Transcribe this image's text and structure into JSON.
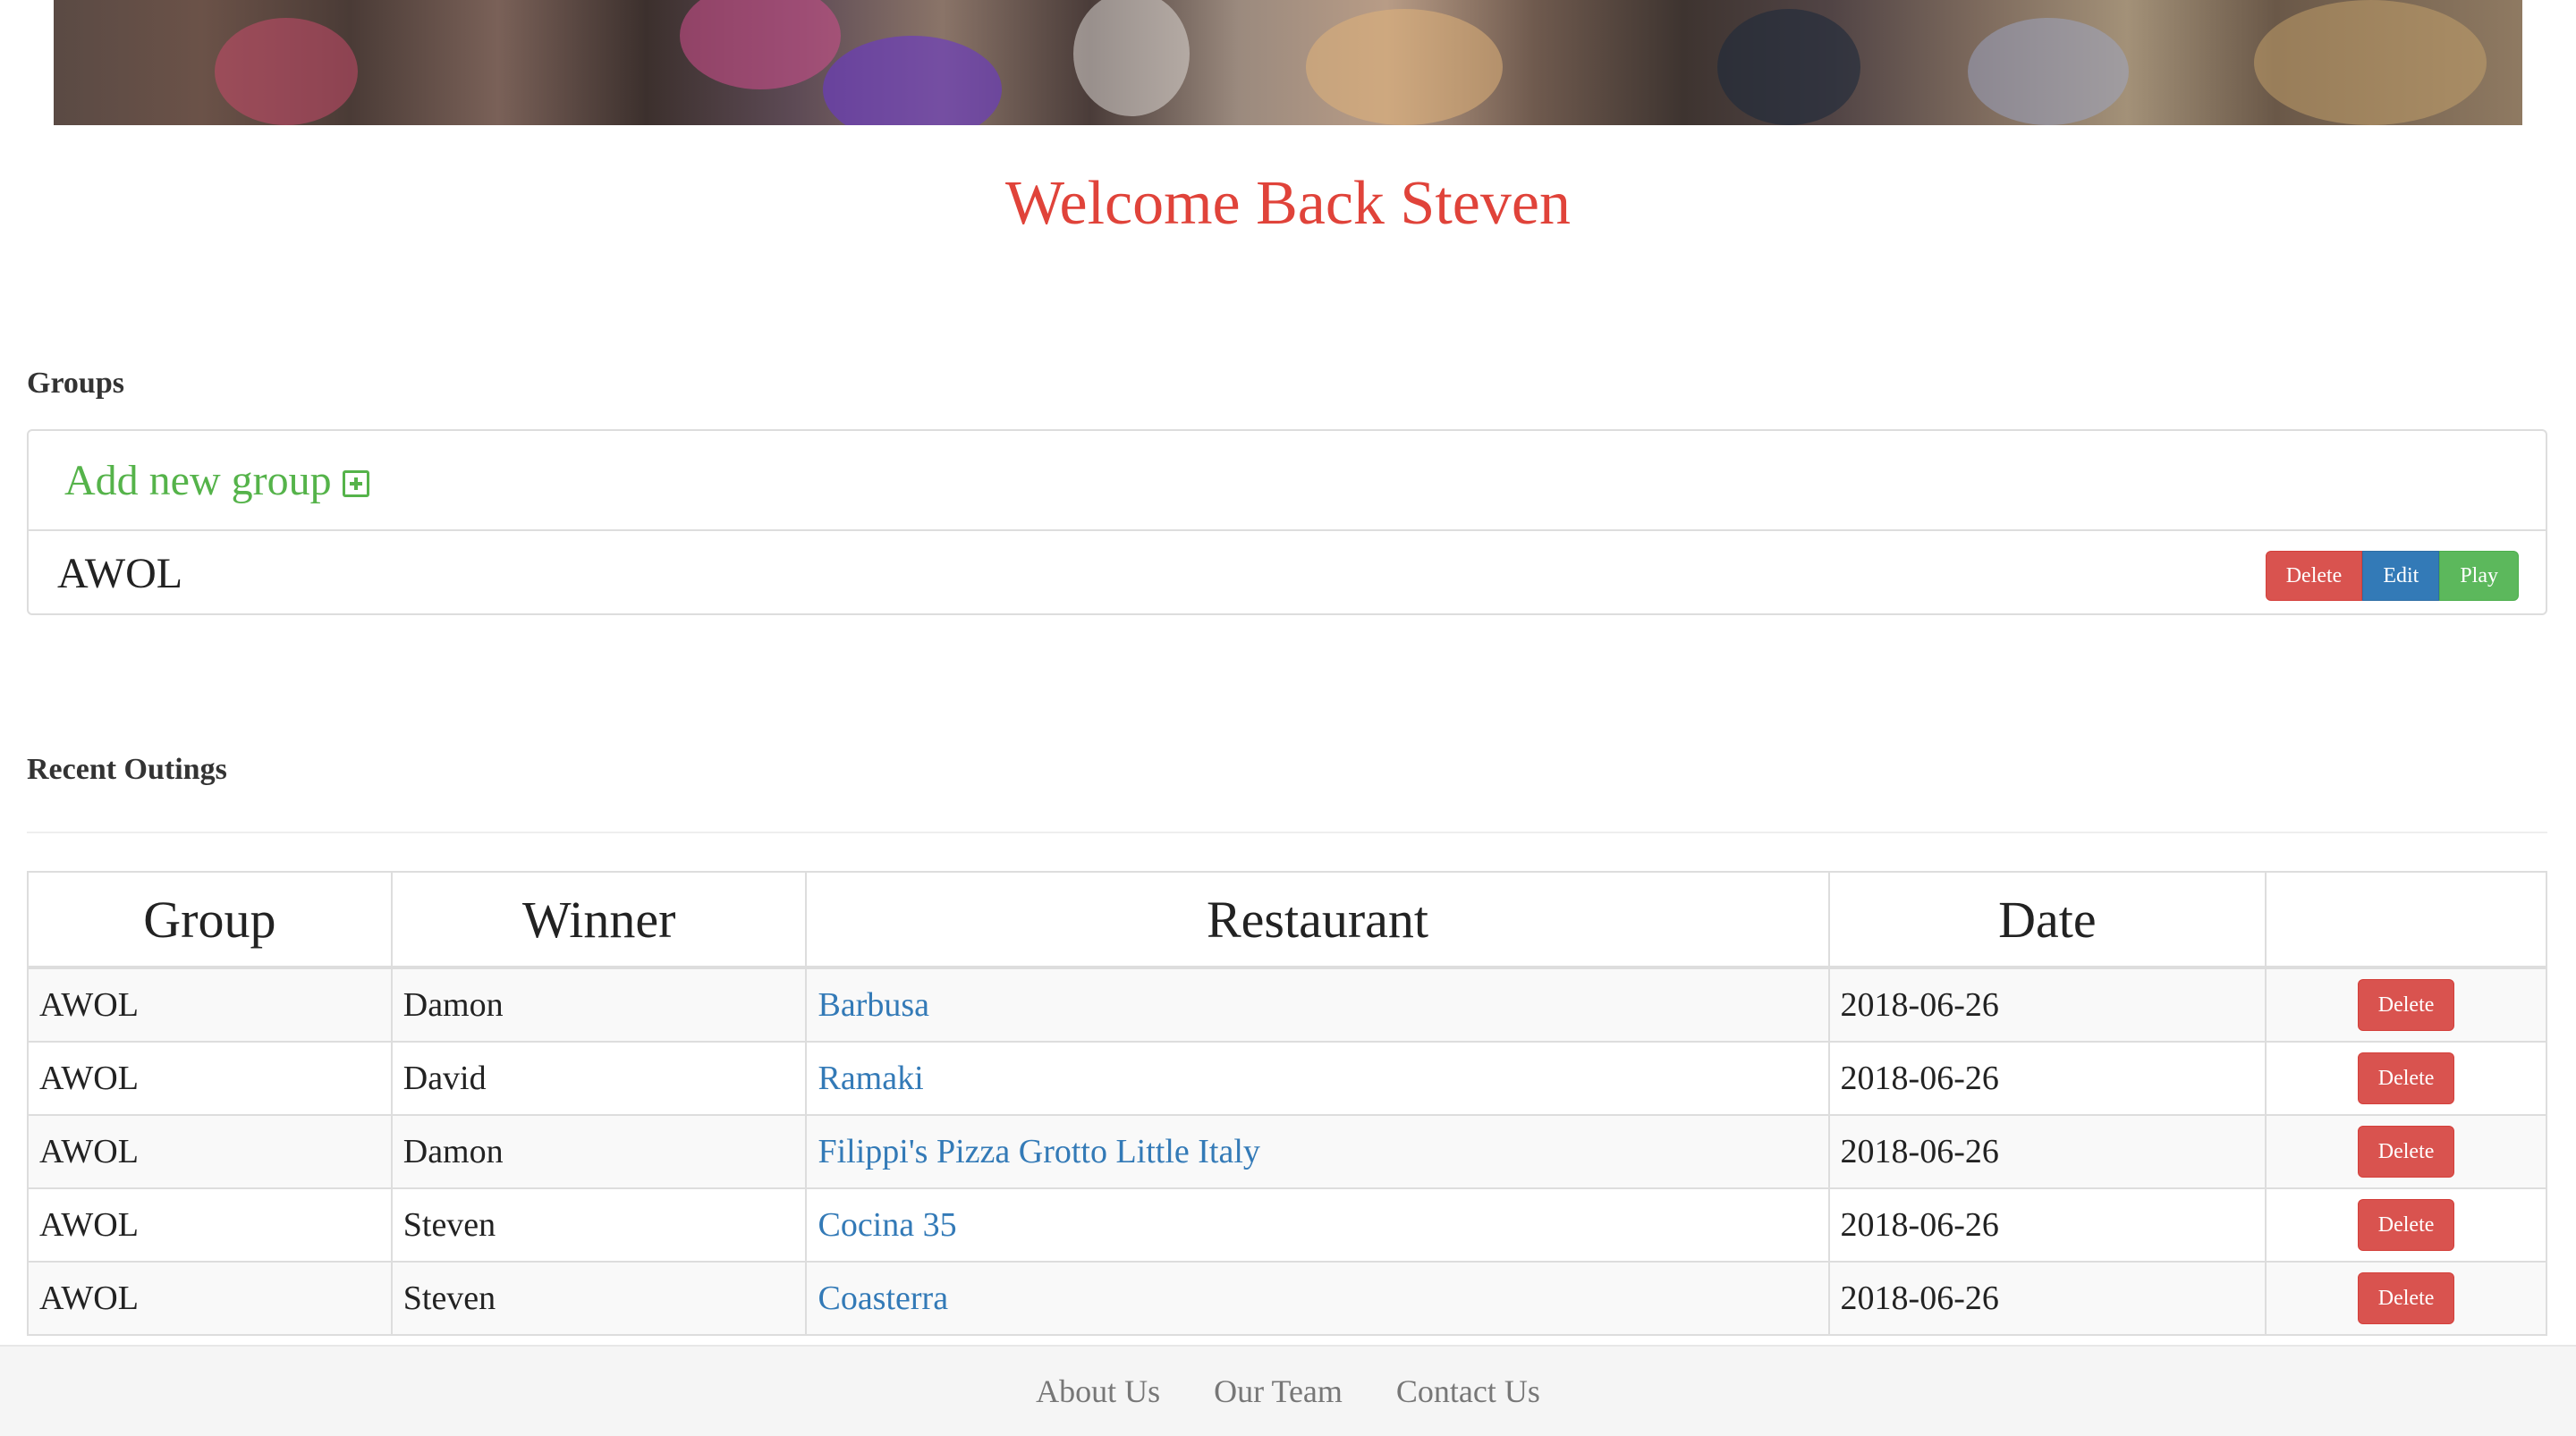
{
  "hero": {
    "image": "restaurant-crowd-photo"
  },
  "welcome": {
    "text": "Welcome Back Steven",
    "color": "#e0433a"
  },
  "groups": {
    "heading": "Groups",
    "add_label": "Add new group",
    "add_icon": "plus-square-icon",
    "items": [
      {
        "name": "AWOL",
        "delete_label": "Delete",
        "edit_label": "Edit",
        "play_label": "Play"
      }
    ]
  },
  "outings": {
    "heading": "Recent Outings",
    "columns": [
      "Group",
      "Winner",
      "Restaurant",
      "Date",
      ""
    ],
    "rows": [
      {
        "group": "AWOL",
        "winner": "Damon",
        "restaurant": "Barbusa",
        "date": "2018-06-26",
        "action": "Delete"
      },
      {
        "group": "AWOL",
        "winner": "David",
        "restaurant": "Ramaki",
        "date": "2018-06-26",
        "action": "Delete"
      },
      {
        "group": "AWOL",
        "winner": "Damon",
        "restaurant": "Filippi's Pizza Grotto Little Italy",
        "date": "2018-06-26",
        "action": "Delete"
      },
      {
        "group": "AWOL",
        "winner": "Steven",
        "restaurant": "Cocina 35",
        "date": "2018-06-26",
        "action": "Delete"
      },
      {
        "group": "AWOL",
        "winner": "Steven",
        "restaurant": "Coasterra",
        "date": "2018-06-26",
        "action": "Delete"
      }
    ]
  },
  "footer": {
    "links": [
      "About Us",
      "Our Team",
      "Contact Us"
    ]
  },
  "colors": {
    "danger": "#d9534f",
    "primary": "#337ab7",
    "success": "#5cb85c",
    "add_green": "#55b34a",
    "link": "#337ab7"
  }
}
